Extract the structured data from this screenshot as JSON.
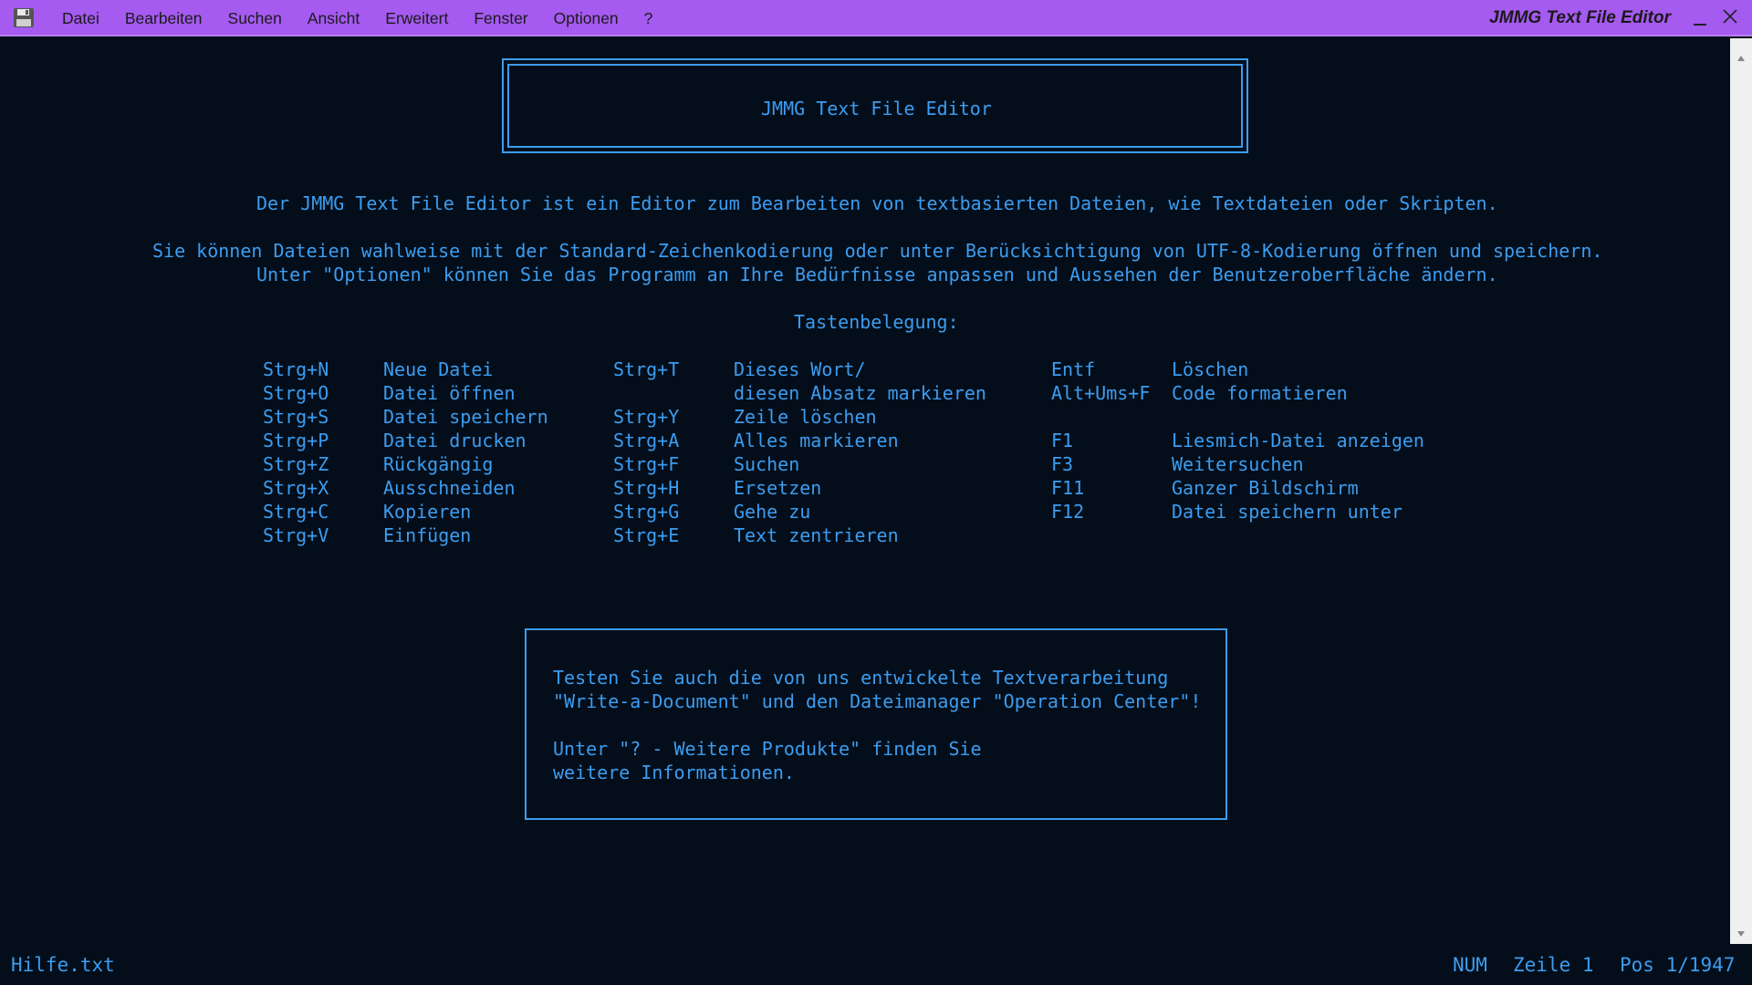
{
  "titlebar": {
    "menu": [
      "Datei",
      "Bearbeiten",
      "Suchen",
      "Ansicht",
      "Erweitert",
      "Fenster",
      "Optionen",
      "?"
    ],
    "window_title": "JMMG Text File Editor",
    "icons": {
      "app": "floppy-disk-icon",
      "minimize": "minimize-icon",
      "close": "close-icon"
    },
    "colors": {
      "background": "#a55af0",
      "text": "#1a1a1a"
    }
  },
  "document": {
    "header": "JMMG Text File Editor",
    "intro": "Der JMMG Text File Editor ist ein Editor zum Bearbeiten von textbasierten Dateien, wie Textdateien oder Skripten.",
    "encoding_line1": "Sie können Dateien wahlweise mit der Standard-Zeichenkodierung oder unter Berücksichtigung von UTF-8-Kodierung öffnen und speichern.",
    "encoding_line2": "Unter \"Optionen\" können Sie das Programm an Ihre Bedürfnisse anpassen und Aussehen der Benutzeroberfläche ändern.",
    "shortcuts_title": "Tastenbelegung:",
    "shortcuts_col1": [
      [
        "Strg+N",
        "Neue Datei"
      ],
      [
        "Strg+O",
        "Datei öffnen"
      ],
      [
        "Strg+S",
        "Datei speichern"
      ],
      [
        "Strg+P",
        "Datei drucken"
      ],
      [
        "Strg+Z",
        "Rückgängig"
      ],
      [
        "Strg+X",
        "Ausschneiden"
      ],
      [
        "Strg+C",
        "Kopieren"
      ],
      [
        "Strg+V",
        "Einfügen"
      ]
    ],
    "shortcuts_col2": [
      [
        "Strg+T",
        "Dieses Wort/"
      ],
      [
        "",
        "diesen Absatz markieren"
      ],
      [
        "Strg+Y",
        "Zeile löschen"
      ],
      [
        "Strg+A",
        "Alles markieren"
      ],
      [
        "Strg+F",
        "Suchen"
      ],
      [
        "Strg+H",
        "Ersetzen"
      ],
      [
        "Strg+G",
        "Gehe zu"
      ],
      [
        "Strg+E",
        "Text zentrieren"
      ]
    ],
    "shortcuts_col3": [
      [
        "Entf",
        "Löschen"
      ],
      [
        "Alt+Ums+F",
        "Code formatieren"
      ],
      [
        "",
        ""
      ],
      [
        "F1",
        "Liesmich-Datei anzeigen"
      ],
      [
        "F3",
        "Weitersuchen"
      ],
      [
        "F11",
        "Ganzer Bildschirm"
      ],
      [
        "F12",
        "Datei speichern unter"
      ],
      [
        "",
        ""
      ]
    ],
    "promo": [
      "Testen Sie auch die von uns entwickelte Textverarbeitung",
      "\"Write-a-Document\" und den Dateimanager \"Operation Center\"!",
      "",
      "Unter \"? - Weitere Produkte\" finden Sie",
      "weitere Informationen."
    ],
    "colors": {
      "background": "#030e1a",
      "text": "#3d9cf0"
    }
  },
  "scrollbar": {
    "icons": {
      "up": "scroll-up-arrow-icon",
      "down": "scroll-down-arrow-icon"
    }
  },
  "statusbar": {
    "filename": "Hilfe.txt",
    "num": "NUM",
    "line": "Zeile 1",
    "pos": "Pos 1/1947"
  }
}
